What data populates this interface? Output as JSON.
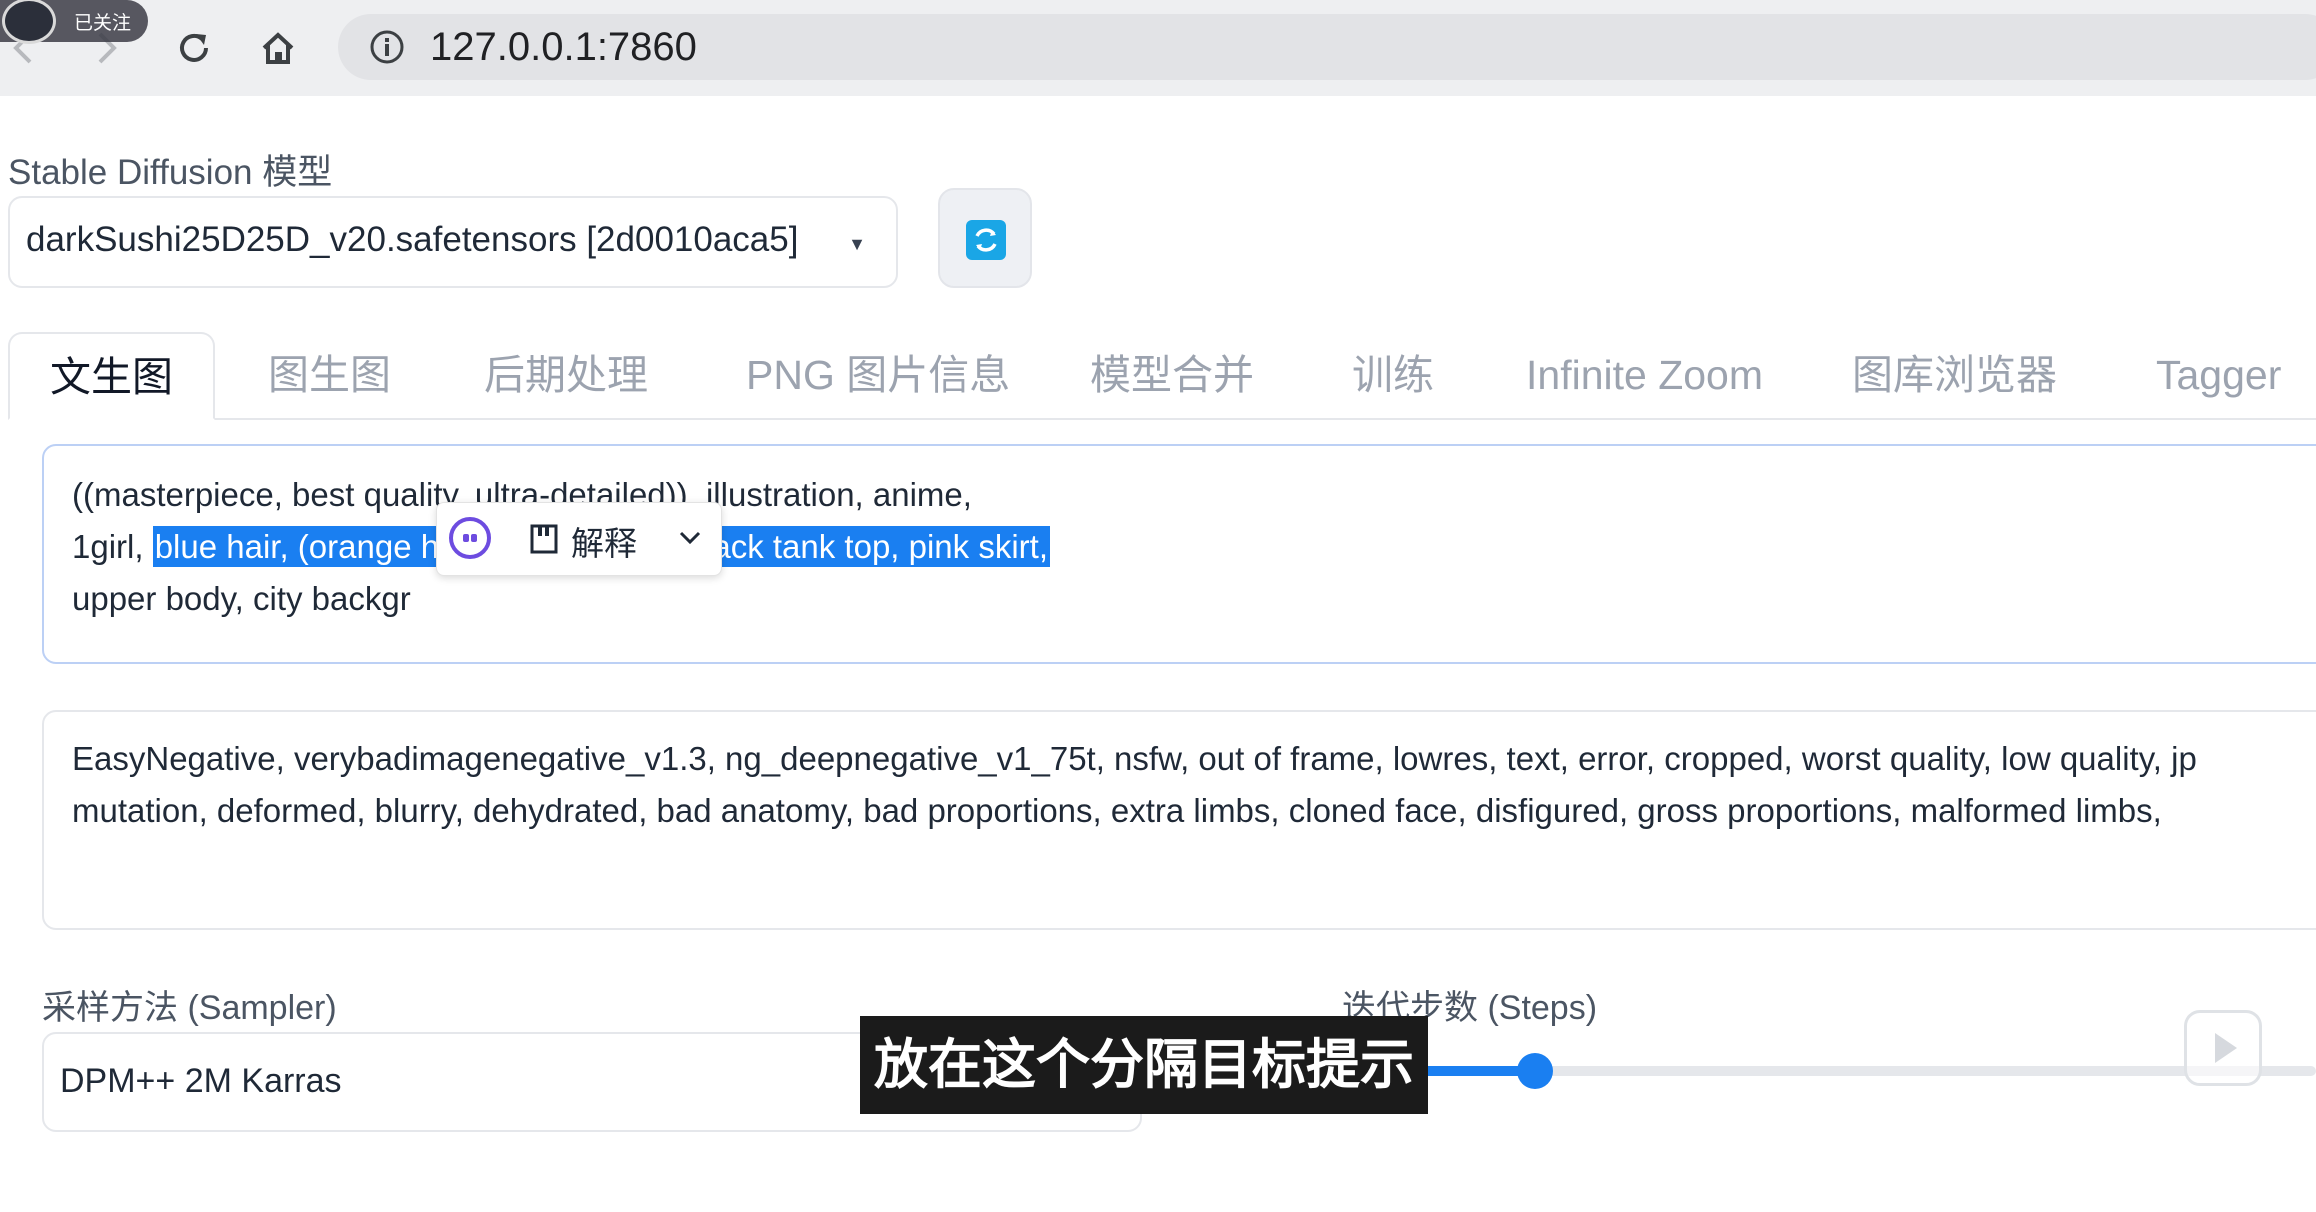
{
  "browser": {
    "url": "127.0.0.1:7860",
    "follow_badge": "已关注"
  },
  "model": {
    "label": "Stable Diffusion 模型",
    "selected": "darkSushi25D25D_v20.safetensors [2d0010aca5]"
  },
  "tabs": [
    {
      "label": "文生图",
      "active": true
    },
    {
      "label": "图生图"
    },
    {
      "label": "后期处理"
    },
    {
      "label": "PNG 图片信息"
    },
    {
      "label": "模型合并"
    },
    {
      "label": "训练"
    },
    {
      "label": "Infinite Zoom"
    },
    {
      "label": "图库浏览器"
    },
    {
      "label": "Tagger"
    }
  ],
  "prompt": {
    "line1": "((masterpiece, best quality, ultra-detailed)), illustration, anime,",
    "line2_pre": "1girl,",
    "line2_selected": "blue hair, (orange hat), white jacket, black tank top, pink skirt,",
    "line3": "upper body, city backgr"
  },
  "popup": {
    "label": "解释"
  },
  "negative_prompt": {
    "line1": "EasyNegative,  verybadimagenegative_v1.3, ng_deepnegative_v1_75t, nsfw, out of frame, lowres, text, error, cropped, worst quality, low quality, jp",
    "line2": "mutation, deformed, blurry, dehydrated, bad anatomy, bad proportions, extra limbs, cloned face, disfigured, gross proportions, malformed limbs,"
  },
  "sampler": {
    "label": "采样方法 (Sampler)",
    "value": "DPM++ 2M Karras"
  },
  "steps": {
    "label": "迭代步数 (Steps)",
    "fraction": 0.2
  },
  "subtitle": "放在这个分隔目标提示词里",
  "colors": {
    "accent": "#1a7ff1",
    "selection": "#1a7ff1",
    "refresh_icon": "#1aa6e6"
  }
}
